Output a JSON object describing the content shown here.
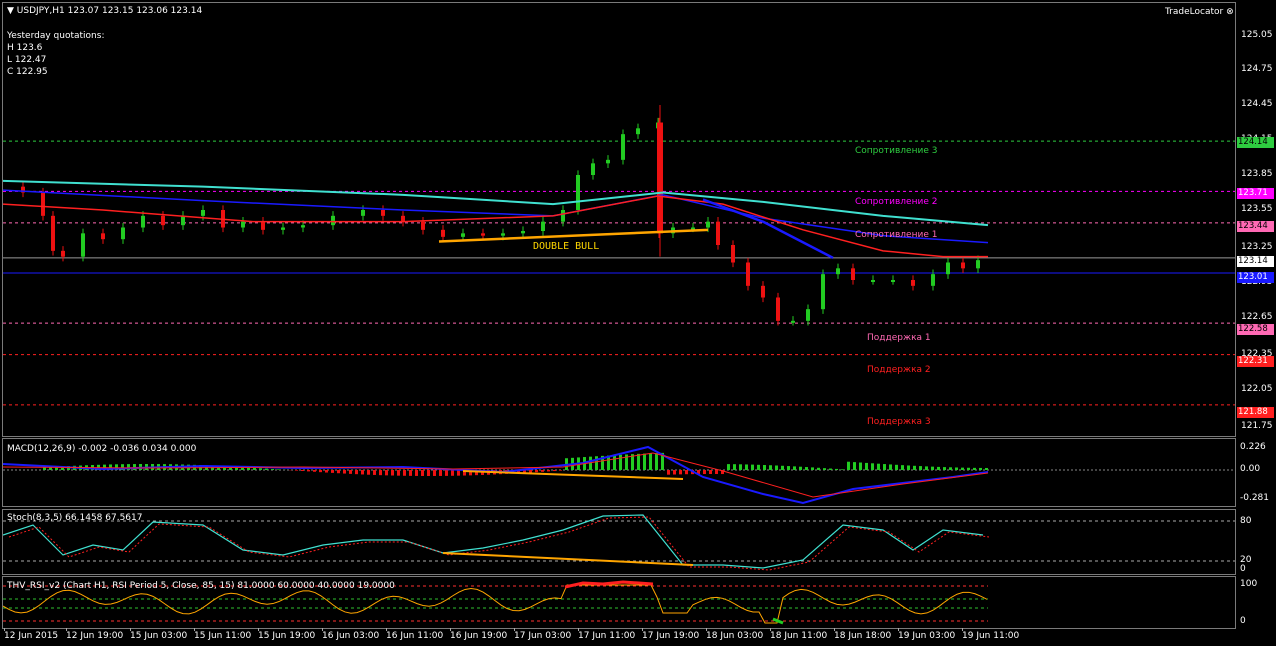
{
  "main": {
    "symbol_header": "USDJPY,H1  123.07 123.15 123.06 123.14",
    "yesterday": {
      "title": "Yesterday quotations:",
      "h": "H 123.6",
      "l": "L 122.47",
      "c": "C 122.95"
    },
    "tradelocator": "TradeLocator",
    "annotation": "DOUBLE BULL",
    "levels": [
      {
        "label": "Сопротивление 3",
        "tag": "124.14",
        "color": "#2ecc40"
      },
      {
        "label": "Сопротивление 2",
        "tag": "123.71",
        "color": "#ff00ff"
      },
      {
        "label": "Сопротивление 1",
        "tag": "123.44",
        "color": "#ff69b4"
      },
      {
        "label": "Поддержка 1",
        "tag": "122.58",
        "color": "#ff69b4"
      },
      {
        "label": "Поддержка 2",
        "tag": "122.31",
        "color": "#ff2020"
      },
      {
        "label": "Поддержка 3",
        "tag": "121.88",
        "color": "#ff2020"
      }
    ],
    "current_price_tag": "123.14",
    "blue_line_tag": "123.01",
    "price_axis": [
      "125.05",
      "124.75",
      "124.45",
      "124.15",
      "123.85",
      "123.55",
      "123.25",
      "122.95",
      "122.65",
      "122.35",
      "122.05",
      "121.75"
    ]
  },
  "macd": {
    "label": "MACD(12,26,9) -0.002 -0.036 0.034 0.000",
    "axis": [
      "0.226",
      "0.00",
      "-0.281"
    ]
  },
  "stoch": {
    "label": "Stoch(8,3,5) 66.1458 67.5617",
    "axis": [
      "80",
      "20",
      "0"
    ]
  },
  "rsi": {
    "label": "THV_RSI_v2   (Chart H1,  RSI Period 5,  Close,  85,  15)  81.0000 60.0000 40.0000 19.0000",
    "axis": [
      "100",
      "0"
    ]
  },
  "time_axis": [
    "12 Jun 2015",
    "12 Jun 19:00",
    "15 Jun 03:00",
    "15 Jun 11:00",
    "15 Jun 19:00",
    "16 Jun 03:00",
    "16 Jun 11:00",
    "16 Jun 19:00",
    "17 Jun 03:00",
    "17 Jun 11:00",
    "17 Jun 19:00",
    "18 Jun 03:00",
    "18 Jun 11:00",
    "18 Jun 18:00",
    "19 Jun 03:00",
    "19 Jun 11:00"
  ],
  "colors": {
    "bull": "#22cc22",
    "bear": "#ee1111",
    "cyan_ma": "#40e0d0",
    "blue_ma": "#1a1aff",
    "red_ma": "#ff2020",
    "orange": "#ffa500"
  }
}
